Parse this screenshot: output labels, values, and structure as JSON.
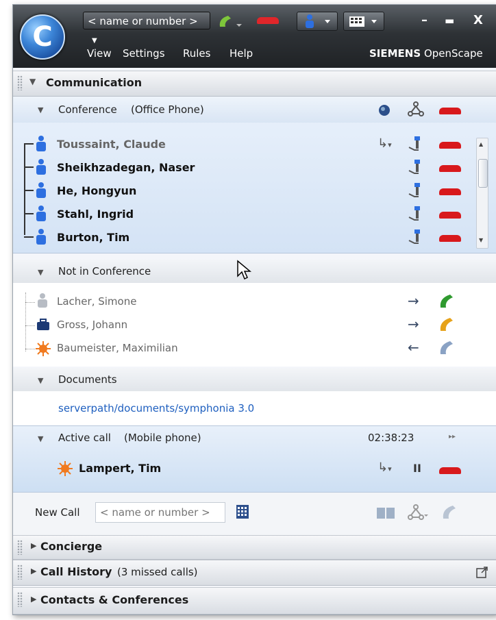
{
  "titlebar": {
    "name_field": "< name or number >",
    "menu": [
      "View",
      "Settings",
      "Rules",
      "Help"
    ],
    "brand_bold": "SIEMENS",
    "brand_light": "OpenScape"
  },
  "communication": {
    "title": "Communication"
  },
  "conference": {
    "label": "Conference",
    "device": "(Office Phone)",
    "participants": [
      {
        "name": "Toussaint, Claude",
        "bold": false
      },
      {
        "name": "Sheikhzadegan, Naser",
        "bold": true
      },
      {
        "name": "He, Hongyun",
        "bold": true
      },
      {
        "name": "Stahl, Ingrid",
        "bold": true
      },
      {
        "name": "Burton, Tim",
        "bold": true
      }
    ]
  },
  "not_in_conference": {
    "label": "Not in Conference",
    "people": [
      {
        "name": "Lacher, Simone",
        "arrow": "→",
        "phone_color": "#2f9a2f"
      },
      {
        "name": "Gross, Johann",
        "arrow": "→",
        "phone_color": "#e6a21a"
      },
      {
        "name": "Baumeister, Maximilian",
        "arrow": "←",
        "phone_color": "#8aa2c4"
      }
    ]
  },
  "documents": {
    "label": "Documents",
    "path": "serverpath/documents/symphonia 3.0"
  },
  "active_call": {
    "label": "Active call",
    "device": "(Mobile phone)",
    "timer": "02:38:23",
    "caller": "Lampert, Tim"
  },
  "new_call": {
    "label": "New Call",
    "placeholder": "< name or number >"
  },
  "sections": {
    "concierge": "Concierge",
    "call_history": "Call History",
    "call_history_note": "(3 missed calls)",
    "contacts": "Contacts & Conferences"
  },
  "colors": {
    "accent_blue": "#1e5fbf",
    "hangup_red": "#d8191c",
    "conf_bg": "#dbe7f6"
  }
}
